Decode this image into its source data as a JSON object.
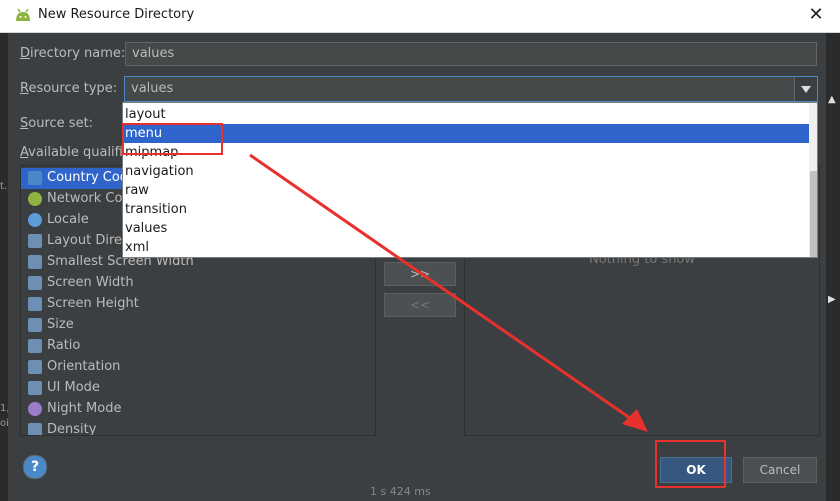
{
  "window": {
    "title": "New Resource Directory",
    "close_glyph": "✕"
  },
  "form": {
    "directory_name_label_prefix": "D",
    "directory_name_label_rest": "irectory name:",
    "directory_name_value": "values",
    "resource_type_label_prefix": "R",
    "resource_type_label_rest": "esource type:",
    "resource_type_value": "values",
    "source_set_label_prefix": "S",
    "source_set_label_rest": "ource set:",
    "available_qualifiers_label_prefix": "A",
    "available_qualifiers_label_rest": "vailable qualifiers:"
  },
  "resource_type_dropdown": {
    "options": [
      "layout",
      "menu",
      "mipmap",
      "navigation",
      "raw",
      "transition",
      "values",
      "xml"
    ],
    "highlighted": "menu"
  },
  "qualifiers": {
    "items": [
      {
        "label": "Country Code",
        "icon": "globe-flag-icon",
        "color": "#4a88c7"
      },
      {
        "label": "Network Code",
        "icon": "network-icon",
        "color": "#8fb341"
      },
      {
        "label": "Locale",
        "icon": "globe-icon",
        "color": "#5a9bd8"
      },
      {
        "label": "Layout Direction",
        "icon": "layout-direction-icon",
        "color": "#6d8fb3"
      },
      {
        "label": "Smallest Screen Width",
        "icon": "smallest-width-icon",
        "color": "#6d8fb3"
      },
      {
        "label": "Screen Width",
        "icon": "screen-width-icon",
        "color": "#6d8fb3"
      },
      {
        "label": "Screen Height",
        "icon": "screen-height-icon",
        "color": "#6d8fb3"
      },
      {
        "label": "Size",
        "icon": "size-icon",
        "color": "#6d8fb3"
      },
      {
        "label": "Ratio",
        "icon": "ratio-icon",
        "color": "#6d8fb3"
      },
      {
        "label": "Orientation",
        "icon": "orientation-icon",
        "color": "#6d8fb3"
      },
      {
        "label": "UI Mode",
        "icon": "ui-mode-icon",
        "color": "#6d8fb3"
      },
      {
        "label": "Night Mode",
        "icon": "night-mode-icon",
        "color": "#9b7cc7"
      },
      {
        "label": "Density",
        "icon": "density-icon",
        "color": "#6d8fb3"
      }
    ],
    "selected_index": 0
  },
  "transfer": {
    "add_label": ">>",
    "remove_label": "<<"
  },
  "chosen_qualifiers": {
    "empty_text": "Nothing to show"
  },
  "buttons": {
    "help_label": "?",
    "ok_label": "OK",
    "cancel_label": "Cancel"
  },
  "background": {
    "status_text": "1 s 424 ms"
  },
  "colors": {
    "dialog_bg": "#3c3f41",
    "selection": "#2f65ca",
    "annotation_red": "#e8312c"
  }
}
